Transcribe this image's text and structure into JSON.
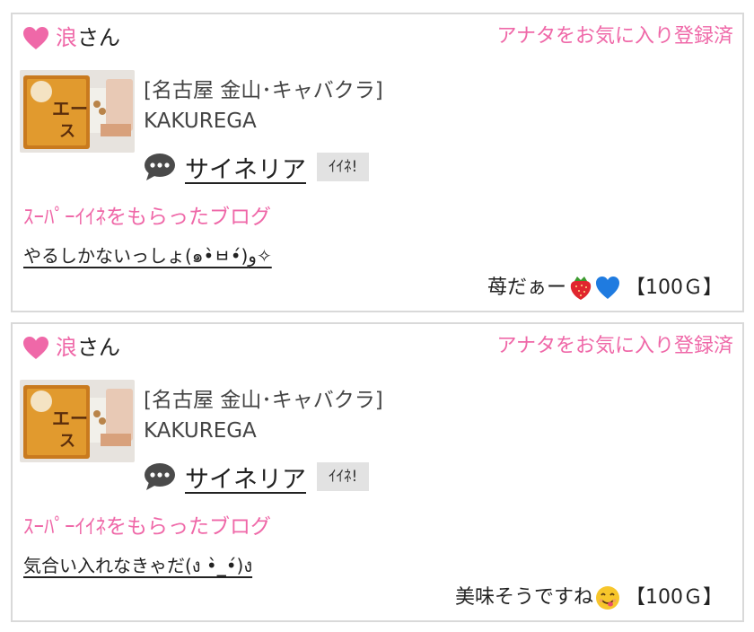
{
  "cards": [
    {
      "nickname": "浪",
      "san": "さん",
      "favorite_status": "アナタをお気に入り登録済",
      "shop_area": "[名古屋 金山･キャバクラ]",
      "shop_name": "KAKUREGA",
      "cast_name": "サイネリア",
      "iine_label": "ｲｲﾈ!",
      "section_title": "ｽｰﾊﾟｰｲｲﾈをもらったブログ",
      "blog_title": "やるしかないっしょ(๑•̀ㅂ•́)و✧",
      "message_text": "苺だぁー",
      "message_emojis": [
        "strawberry-icon",
        "blue-heart-icon"
      ],
      "price": "【100Ｇ】"
    },
    {
      "nickname": "浪",
      "san": "さん",
      "favorite_status": "アナタをお気に入り登録済",
      "shop_area": "[名古屋 金山･キャバクラ]",
      "shop_name": "KAKUREGA",
      "cast_name": "サイネリア",
      "iine_label": "ｲｲﾈ!",
      "section_title": "ｽｰﾊﾟｰｲｲﾈをもらったブログ",
      "blog_title": "気合い入れなきゃだ(ง •̀_•́)ง",
      "message_text": "美味そうですね",
      "message_emojis": [
        "yum-face-icon"
      ],
      "price": "【100Ｇ】"
    }
  ],
  "colors": {
    "accent_pink": "#ef68a8",
    "border": "#d9d9d9",
    "iine_bg": "#e2e2e2"
  }
}
